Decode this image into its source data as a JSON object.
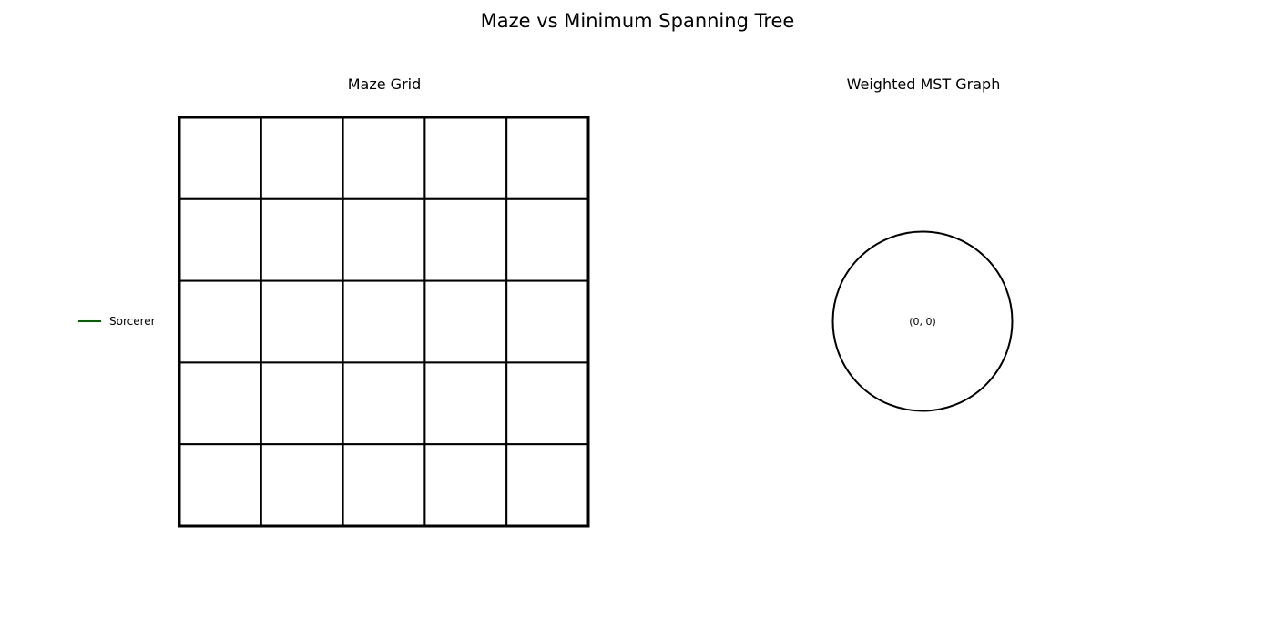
{
  "title": "Maze vs Minimum Spanning Tree",
  "maze": {
    "title": "Maze Grid",
    "rows": 5,
    "cols": 5
  },
  "mst": {
    "title": "Weighted MST Graph",
    "nodes": [
      {
        "label": "(0, 0)"
      }
    ],
    "edges": []
  },
  "legend": {
    "items": [
      {
        "label": "Sorcerer",
        "color": "#006400"
      }
    ]
  }
}
